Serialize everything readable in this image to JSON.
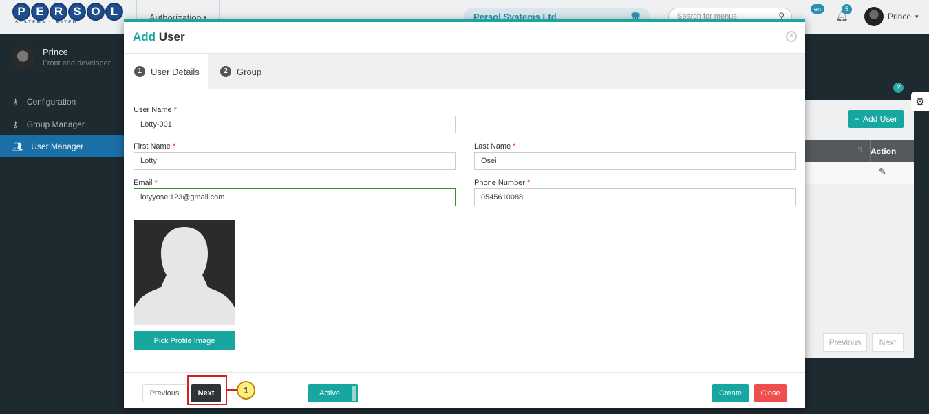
{
  "header": {
    "logo_text": "PERSOL",
    "logo_subtext": "SYSTEMS LIMITED",
    "menu_label": "Authorization",
    "company": "Persol Systems Ltd",
    "search_placeholder": "Search for menus",
    "language_badge": "en",
    "notification_count": "5",
    "user_name": "Prince"
  },
  "sidebar": {
    "user_name": "Prince",
    "user_role": "Front end developer",
    "items": [
      {
        "label": "Configuration",
        "icon": "key-icon"
      },
      {
        "label": "Group Manager",
        "icon": "key-icon"
      },
      {
        "label": "User Manager",
        "icon": "users-icon",
        "active": true
      }
    ]
  },
  "background_page": {
    "add_user_label": "Add User",
    "action_header": "Action",
    "pager_previous": "Previous",
    "pager_next": "Next",
    "help_glyph": "?"
  },
  "modal": {
    "title_accent": "Add",
    "title_rest": "User",
    "tabs": [
      {
        "number": "1",
        "label": "User Details",
        "active": true
      },
      {
        "number": "2",
        "label": "Group",
        "active": false
      }
    ],
    "fields": {
      "username": {
        "label": "User Name",
        "value": "Lotty-001"
      },
      "first_name": {
        "label": "First Name",
        "value": "Lotty"
      },
      "last_name": {
        "label": "Last Name",
        "value": "Osei"
      },
      "email": {
        "label": "Email",
        "value": "lotyyosei123@gmail.com"
      },
      "phone": {
        "label": "Phone Number",
        "value": "0545610088"
      }
    },
    "required_marker": "*",
    "pick_image_label": "Pick Profile Image",
    "footer": {
      "previous_label": "Previous",
      "next_label": "Next",
      "callout_number": "1",
      "status_toggle_label": "Active",
      "create_label": "Create",
      "close_label": "Close"
    }
  },
  "colors": {
    "accent": "#17a7a0",
    "danger": "#f04e4e",
    "highlight": "#d42020",
    "sidebar_bg": "#1d2a30",
    "active_nav": "#1b6fa8"
  }
}
